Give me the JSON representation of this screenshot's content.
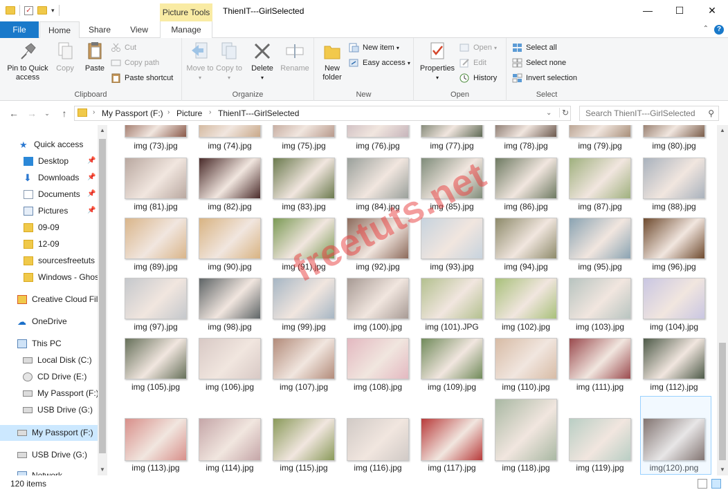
{
  "window": {
    "title": "ThienIT---GirlSelected",
    "context_tab_group": "Picture Tools",
    "minimize": "—",
    "maximize": "☐",
    "close": "✕"
  },
  "tabs": {
    "file": "File",
    "home": "Home",
    "share": "Share",
    "view": "View",
    "manage": "Manage",
    "help": "?"
  },
  "ribbon": {
    "clipboard": {
      "label": "Clipboard",
      "pin": "Pin to Quick access",
      "copy": "Copy",
      "paste": "Paste",
      "cut": "Cut",
      "copy_path": "Copy path",
      "paste_shortcut": "Paste shortcut"
    },
    "organize": {
      "label": "Organize",
      "move_to": "Move to",
      "copy_to": "Copy to",
      "delete": "Delete",
      "rename": "Rename"
    },
    "new": {
      "label": "New",
      "new_folder": "New folder",
      "new_item": "New item",
      "easy_access": "Easy access"
    },
    "open": {
      "label": "Open",
      "properties": "Properties",
      "open": "Open",
      "edit": "Edit",
      "history": "History"
    },
    "select": {
      "label": "Select",
      "select_all": "Select all",
      "select_none": "Select none",
      "invert_selection": "Invert selection"
    }
  },
  "address": {
    "crumbs": [
      "My Passport (F:)",
      "Picture",
      "ThienIT---GirlSelected"
    ],
    "search_placeholder": "Search ThienIT---GirlSelected"
  },
  "nav": {
    "quick_access": "Quick access",
    "desktop": "Desktop",
    "downloads": "Downloads",
    "documents": "Documents",
    "pictures": "Pictures",
    "f1": "09-09",
    "f2": "12-09",
    "f3": "sourcesfreetuts",
    "f4": "Windows - Ghos",
    "creative_cloud": "Creative Cloud Fil",
    "onedrive": "OneDrive",
    "this_pc": "This PC",
    "local_disk": "Local Disk (C:)",
    "cd_drive": "CD Drive (E:)",
    "my_passport": "My Passport (F:)",
    "usb_drive": "USB Drive (G:)",
    "my_passport_root": "My Passport (F:)",
    "usb_drive_root": "USB Drive (G:)",
    "network": "Network"
  },
  "files": [
    "img (73).jpg",
    "img (74).jpg",
    "img (75).jpg",
    "img (76).jpg",
    "img (77).jpg",
    "img (78).jpg",
    "img (79).jpg",
    "img (80).jpg",
    "img (81).jpg",
    "img (82).jpg",
    "img (83).jpg",
    "img (84).jpg",
    "img (85).jpg",
    "img (86).jpg",
    "img (87).jpg",
    "img (88).jpg",
    "img (89).jpg",
    "img (90).jpg",
    "img (91).jpg",
    "img (92).jpg",
    "img (93).jpg",
    "img (94).jpg",
    "img (95).jpg",
    "img (96).jpg",
    "img (97).jpg",
    "img (98).jpg",
    "img (99).jpg",
    "img (100).jpg",
    "img (101).JPG",
    "img (102).jpg",
    "img (103).jpg",
    "img (104).jpg",
    "img (105).jpg",
    "img (106).jpg",
    "img (107).jpg",
    "img (108).jpg",
    "img (109).jpg",
    "img (110).jpg",
    "img (111).jpg",
    "img (112).jpg",
    "img (113).jpg",
    "img (114).jpg",
    "img (115).jpg",
    "img (116).jpg",
    "img (117).jpg",
    "img (118).jpg",
    "img (119).jpg",
    "img(120).png"
  ],
  "thumb_colors": [
    "#8a5a4a",
    "#c9a98a",
    "#b89a8c",
    "#c7b5bb",
    "#5f6a55",
    "#6d5a4f",
    "#a88f7a",
    "#7a5d4a",
    "#b9a8a0",
    "#4a2b2a",
    "#6b7a4e",
    "#9aa09b",
    "#7f8c7a",
    "#6e7a62",
    "#9fb07e",
    "#a9b2bd",
    "#d9b58a",
    "#d8b382",
    "#7b9a55",
    "#8c6b5c",
    "#c7d3de",
    "#8d8a6a",
    "#8aa3b2",
    "#6e4a2e",
    "#c5c8cc",
    "#5e6466",
    "#a6b6c4",
    "#a79a94",
    "#b3c08f",
    "#a8c07a",
    "#b8c4c0",
    "#c9c6e2",
    "#66705a",
    "#d8c9c5",
    "#b28b7a",
    "#e3b8c0",
    "#708a5a",
    "#d7bba5",
    "#9a4a4e",
    "#4d5a48",
    "#d88f8a",
    "#c5a6a8",
    "#8a9a5a",
    "#d1cac6",
    "#b83a3a",
    "#a9b8a3",
    "#b9cec4",
    "#6a4e42"
  ],
  "status": {
    "item_count": "120 items"
  },
  "watermark": "freetuts.net"
}
